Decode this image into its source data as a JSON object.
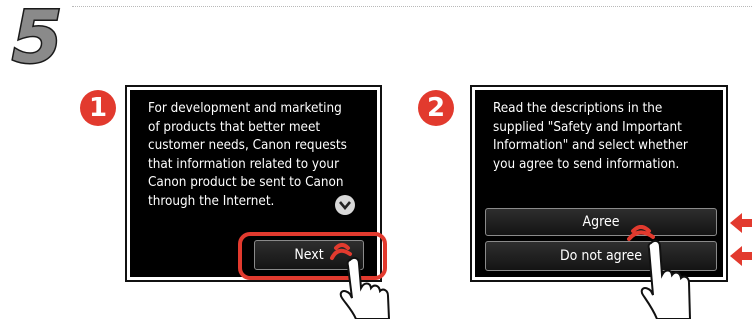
{
  "step_number": "5",
  "colors": {
    "accent": "#e23a2e",
    "screen_bg": "#000000",
    "text": "#ffffff"
  },
  "panel1": {
    "badge": "1",
    "message": "For development and marketing\nof products that better meet\ncustomer needs, Canon requests\nthat information related to your\nCanon product be sent to Canon\nthrough the Internet.",
    "scroll_icon": "chevron-down-icon",
    "next_label": "Next"
  },
  "panel2": {
    "badge": "2",
    "message": "Read the descriptions in the\nsupplied \"Safety and Important\nInformation\" and select whether\nyou agree to send information.",
    "agree_label": "Agree",
    "disagree_label": "Do not agree"
  }
}
